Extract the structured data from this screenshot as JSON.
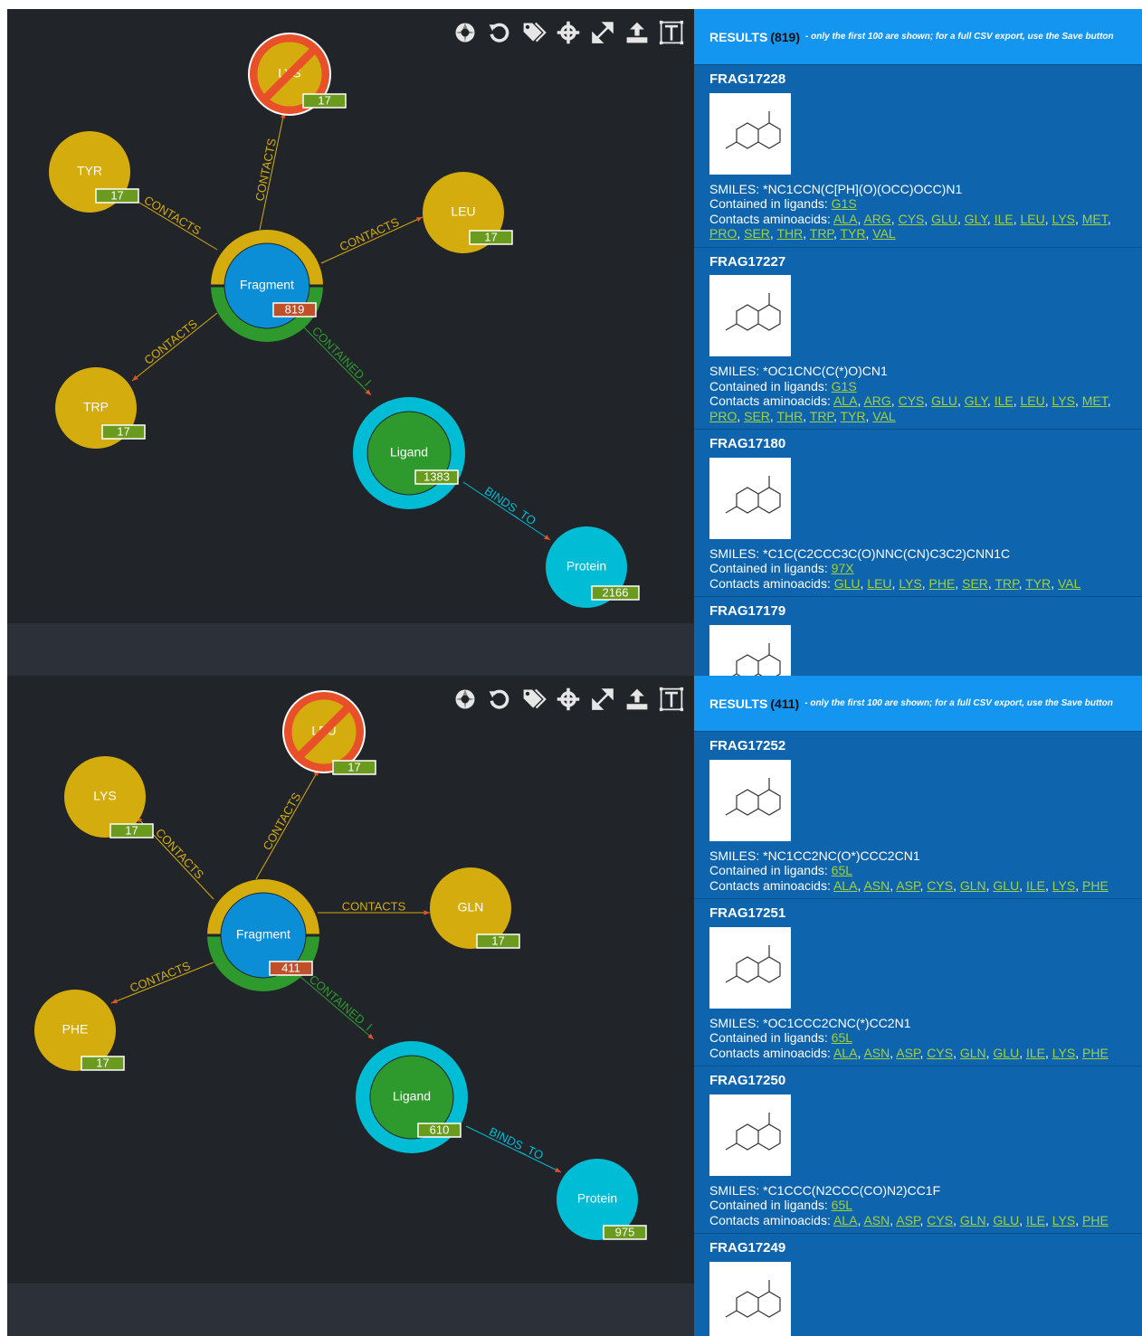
{
  "panels": [
    {
      "toolbar_icons": [
        "cluster-icon",
        "undo-icon",
        "tags-icon",
        "center-icon",
        "expand-icon",
        "upload-icon",
        "text-icon"
      ],
      "nodes": {
        "blocked": {
          "label": "LYS",
          "count": "17"
        },
        "left_top": {
          "label": "TYR",
          "count": "17"
        },
        "right": {
          "label": "LEU",
          "count": "17"
        },
        "left_bottom": {
          "label": "TRP",
          "count": "17"
        },
        "fragment": {
          "label": "Fragment",
          "count": "819"
        },
        "ligand": {
          "label": "Ligand",
          "count": "1383"
        },
        "protein": {
          "label": "Protein",
          "count": "2166"
        }
      },
      "edges": {
        "contacts": "CONTACTS",
        "contained": "CONTAINED_I",
        "binds": "BINDS_TO"
      },
      "results": {
        "title": "RESULTS",
        "count": "(819)",
        "note": "- only the first 100 are shown; for a full CSV export, use the Save button",
        "items": [
          {
            "id": "FRAG17228",
            "smiles": "SMILES: *NC1CCN(C[PH](O)(OCC)OCC)N1",
            "ligands_label": "Contained in ligands: ",
            "ligands": [
              "G1S"
            ],
            "aa_label": "Contacts aminoacids: ",
            "aminoacids": [
              "ALA",
              "ARG",
              "CYS",
              "GLU",
              "GLY",
              "ILE",
              "LEU",
              "LYS",
              "MET",
              "PRO",
              "SER",
              "THR",
              "TRP",
              "TYR",
              "VAL"
            ]
          },
          {
            "id": "FRAG17227",
            "smiles": "SMILES: *OC1CNC(C(*)O)CN1",
            "ligands_label": "Contained in ligands: ",
            "ligands": [
              "G1S"
            ],
            "aa_label": "Contacts aminoacids: ",
            "aminoacids": [
              "ALA",
              "ARG",
              "CYS",
              "GLU",
              "GLY",
              "ILE",
              "LEU",
              "LYS",
              "MET",
              "PRO",
              "SER",
              "THR",
              "TRP",
              "TYR",
              "VAL"
            ]
          },
          {
            "id": "FRAG17180",
            "smiles": "SMILES: *C1C(C2CCC3C(O)NNC(CN)C3C2)CNN1C",
            "ligands_label": "Contained in ligands: ",
            "ligands": [
              "97X"
            ],
            "aa_label": "Contacts aminoacids: ",
            "aminoacids": [
              "GLU",
              "LEU",
              "LYS",
              "PHE",
              "SER",
              "TRP",
              "TYR",
              "VAL"
            ]
          },
          {
            "id": "FRAG17179",
            "smiles": "",
            "ligands_label": "",
            "ligands": [],
            "aa_label": "",
            "aminoacids": []
          }
        ]
      }
    },
    {
      "toolbar_icons": [
        "cluster-icon",
        "undo-icon",
        "tags-icon",
        "center-icon",
        "expand-icon",
        "upload-icon",
        "text-icon"
      ],
      "nodes": {
        "blocked": {
          "label": "LEU",
          "count": "17"
        },
        "left_top": {
          "label": "LYS",
          "count": "17"
        },
        "right": {
          "label": "GLN",
          "count": "17"
        },
        "left_bottom": {
          "label": "PHE",
          "count": "17"
        },
        "fragment": {
          "label": "Fragment",
          "count": "411"
        },
        "ligand": {
          "label": "Ligand",
          "count": "610"
        },
        "protein": {
          "label": "Protein",
          "count": "975"
        }
      },
      "edges": {
        "contacts": "CONTACTS",
        "contained": "CONTAINED_I",
        "binds": "BINDS_TO"
      },
      "results": {
        "title": "RESULTS",
        "count": "(411)",
        "note": "- only the first 100 are shown; for a full CSV export, use the Save button",
        "items": [
          {
            "id": "FRAG17252",
            "smiles": "SMILES: *NC1CC2NC(O*)CCC2CN1",
            "ligands_label": "Contained in ligands: ",
            "ligands": [
              "65L"
            ],
            "aa_label": "Contacts aminoacids: ",
            "aminoacids": [
              "ALA",
              "ASN",
              "ASP",
              "CYS",
              "GLN",
              "GLU",
              "ILE",
              "LYS",
              "PHE"
            ]
          },
          {
            "id": "FRAG17251",
            "smiles": "SMILES: *OC1CCC2CNC(*)CC2N1",
            "ligands_label": "Contained in ligands: ",
            "ligands": [
              "65L"
            ],
            "aa_label": "Contacts aminoacids: ",
            "aminoacids": [
              "ALA",
              "ASN",
              "ASP",
              "CYS",
              "GLN",
              "GLU",
              "ILE",
              "LYS",
              "PHE"
            ]
          },
          {
            "id": "FRAG17250",
            "smiles": "SMILES: *C1CCC(N2CCC(CO)N2)CC1F",
            "ligands_label": "Contained in ligands: ",
            "ligands": [
              "65L"
            ],
            "aa_label": "Contacts aminoacids: ",
            "aminoacids": [
              "ALA",
              "ASN",
              "ASP",
              "CYS",
              "GLN",
              "GLU",
              "ILE",
              "LYS",
              "PHE"
            ]
          },
          {
            "id": "FRAG17249",
            "smiles": "",
            "ligands_label": "",
            "ligands": [],
            "aa_label": "",
            "aminoacids": []
          }
        ]
      }
    }
  ],
  "colors": {
    "graph_bg": "#212529",
    "aminoacid": "#d4ac0d",
    "fragment": "#0b8ed6",
    "fragment_ring_top": "#d4ac0d",
    "fragment_ring_bottom": "#2e9a2e",
    "ligand": "#2e9a2e",
    "ligand_ring": "#00bcd4",
    "protein": "#00bcd4",
    "count_badge": "#6a9a1e",
    "fragment_badge": "#c0502a",
    "results_bg": "#0e64ad",
    "results_header": "#1495f0",
    "link": "#a3d13a"
  }
}
